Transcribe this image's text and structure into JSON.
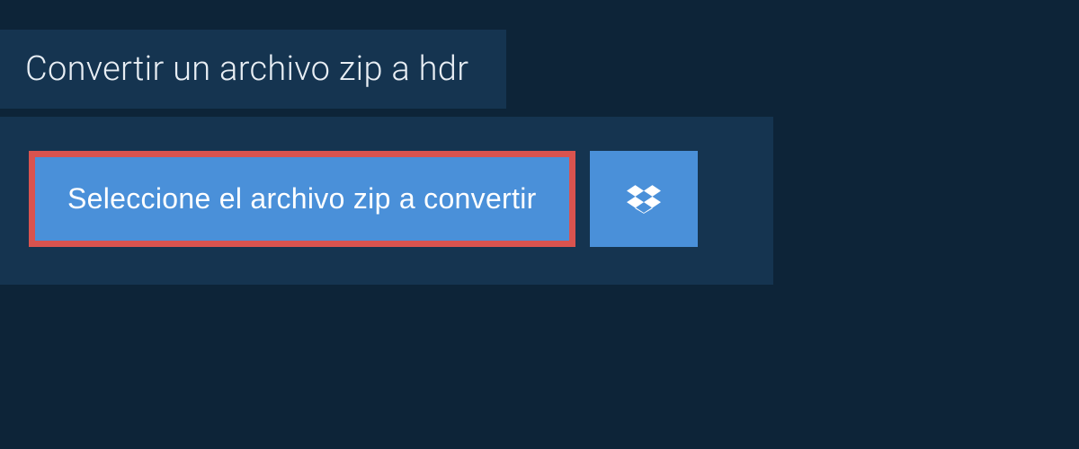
{
  "header": {
    "title": "Convertir un archivo zip a hdr"
  },
  "main": {
    "select_button_label": "Seleccione el archivo zip a convertir",
    "dropbox_icon_name": "dropbox"
  }
}
